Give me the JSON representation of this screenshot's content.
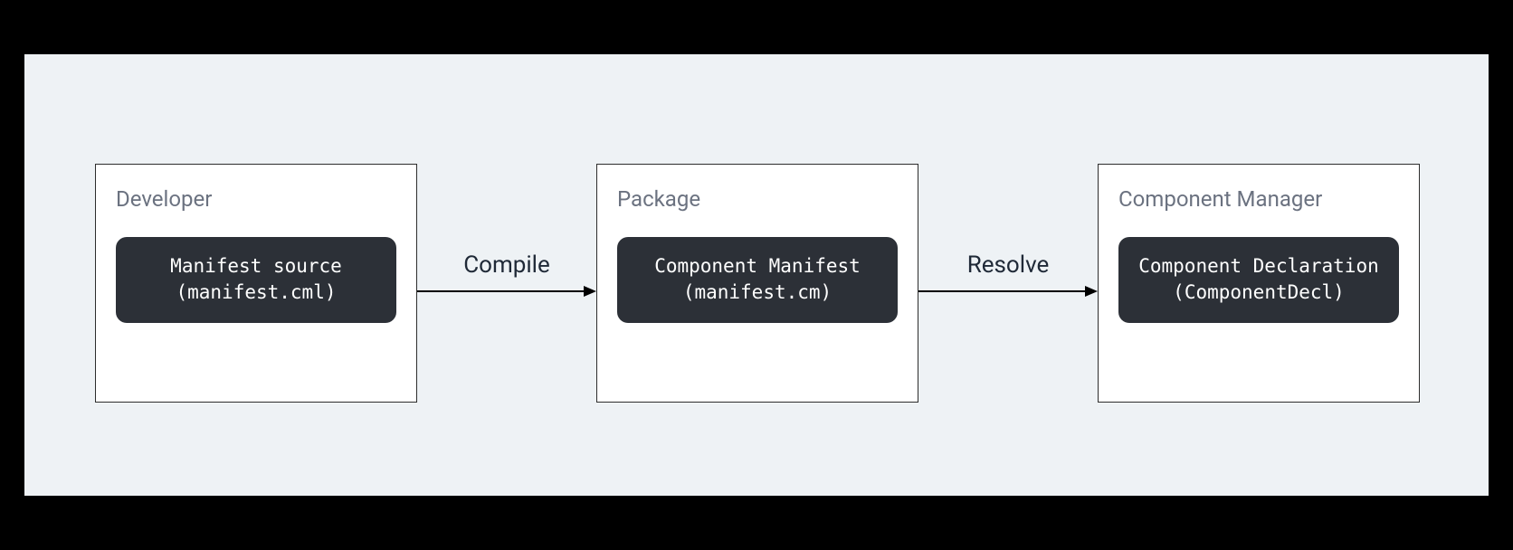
{
  "stages": [
    {
      "label": "Developer",
      "pill_line1": "Manifest source",
      "pill_line2": "(manifest.cml)"
    },
    {
      "label": "Package",
      "pill_line1": "Component Manifest",
      "pill_line2": "(manifest.cm)"
    },
    {
      "label": "Component Manager",
      "pill_line1": "Component Declaration",
      "pill_line2": "(ComponentDecl)"
    }
  ],
  "arrows": [
    {
      "label": "Compile"
    },
    {
      "label": "Resolve"
    }
  ]
}
